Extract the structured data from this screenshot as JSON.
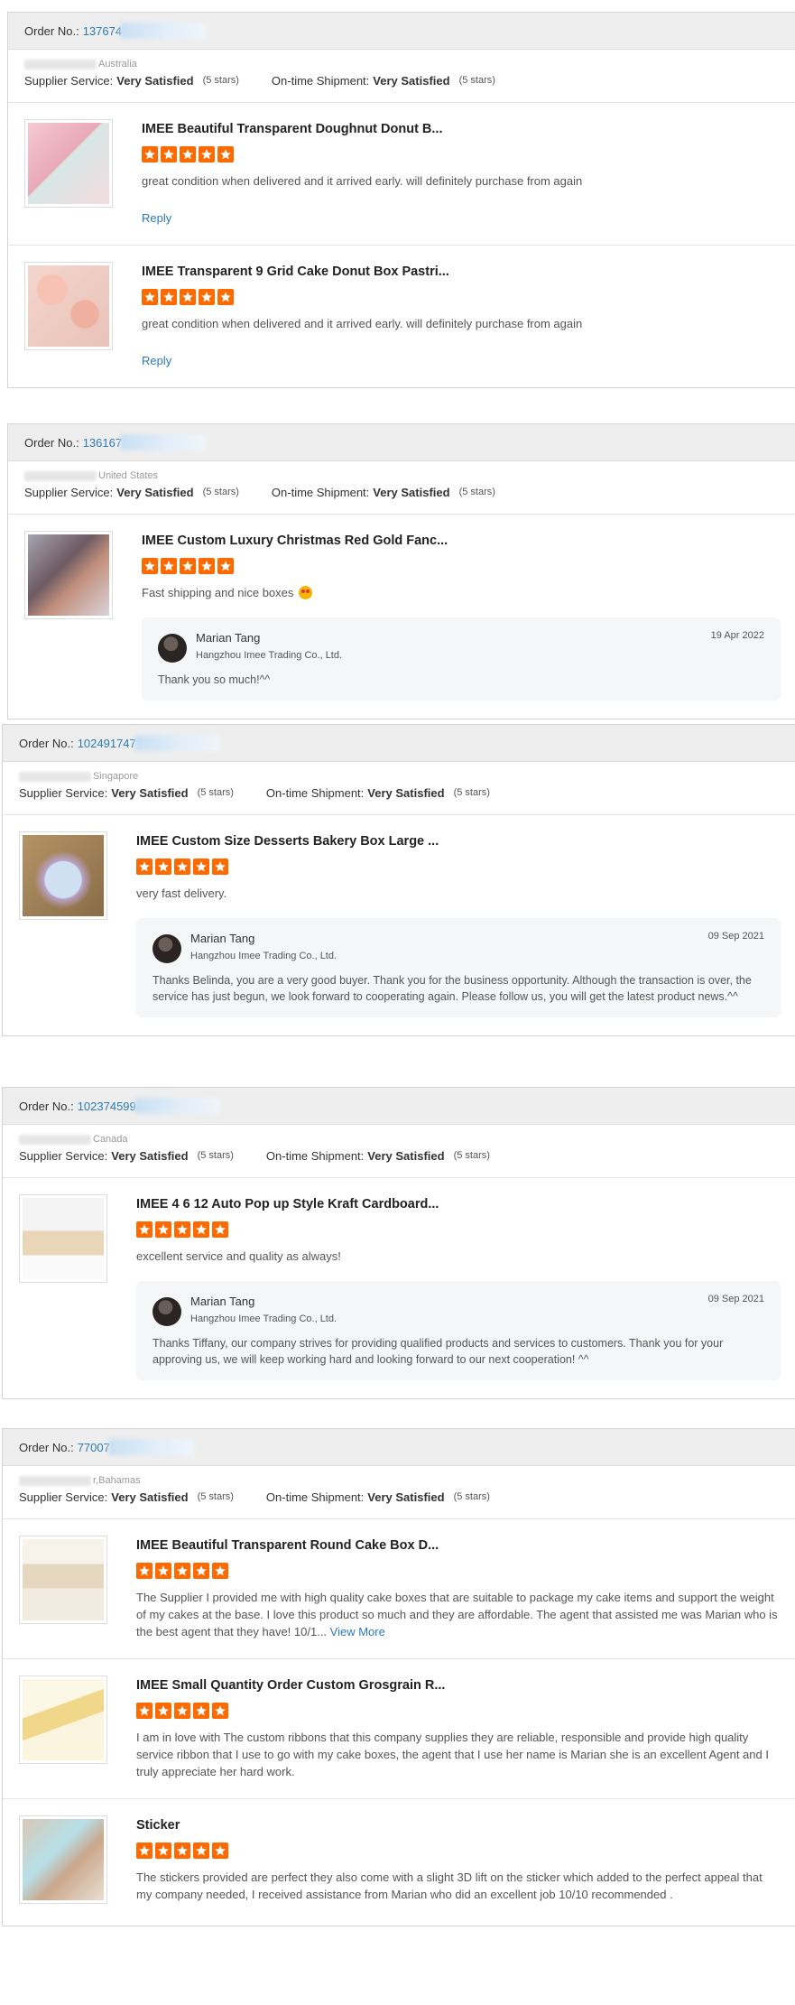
{
  "labels": {
    "order_no": "Order No.:",
    "supplier_service": "Supplier Service:",
    "on_time_shipment": "On-time Shipment:",
    "reply": "Reply"
  },
  "colors": {
    "accent": "#2a7ab8",
    "star": "#ff6a00",
    "header_bg": "#eeeeee"
  },
  "orders": [
    {
      "order_no": "137674",
      "country": "Australia",
      "supplier_service": "Very Satisfied",
      "supplier_stars": "(5 stars)",
      "shipment": "Very Satisfied",
      "shipment_stars": "(5 stars)",
      "items": [
        {
          "title": "IMEE Beautiful Transparent Doughnut Donut B...",
          "rating": 5,
          "text": "great condition when delivered and it arrived early. will definitely purchase from again",
          "reply_link": "Reply",
          "thumb": "pink-donut-box"
        },
        {
          "title": "IMEE Transparent 9 Grid Cake Donut Box Pastri...",
          "rating": 5,
          "text": "great condition when delivered and it arrived early. will definitely purchase from again",
          "reply_link": "Reply",
          "thumb": "nine-grid-box"
        }
      ]
    },
    {
      "order_no": "136167",
      "country": "United States",
      "supplier_service": "Very Satisfied",
      "supplier_stars": "(5 stars)",
      "shipment": "Very Satisfied",
      "shipment_stars": "(5 stars)",
      "items": [
        {
          "title": "IMEE Custom Luxury Christmas Red Gold Fanc...",
          "rating": 5,
          "text": "Fast shipping and nice boxes",
          "emoji": "star-struck-emoji",
          "thumb": "christmas-box",
          "reply": {
            "name": "Marian Tang",
            "company": "Hangzhou Imee Trading Co., Ltd.",
            "date": "19 Apr 2022",
            "text": "Thank you so much!^^"
          }
        }
      ]
    },
    {
      "order_no": "102491747",
      "country": "Singapore",
      "supplier_service": "Very Satisfied",
      "supplier_stars": "(5 stars)",
      "shipment": "Very Satisfied",
      "shipment_stars": "(5 stars)",
      "items": [
        {
          "title": "IMEE Custom Size Desserts Bakery Box Large ...",
          "rating": 5,
          "text": "very fast delivery.",
          "thumb": "dessert-box",
          "reply": {
            "name": "Marian Tang",
            "company": "Hangzhou Imee Trading Co., Ltd.",
            "date": "09 Sep 2021",
            "text": "Thanks Belinda, you are a very good buyer. Thank you for the business opportunity. Although the transaction is over, the service has just begun, we look forward to cooperating again. Please follow us, you will get the latest product news.^^"
          }
        }
      ]
    },
    {
      "order_no": "102374599",
      "country": "Canada",
      "supplier_service": "Very Satisfied",
      "supplier_stars": "(5 stars)",
      "shipment": "Very Satisfied",
      "shipment_stars": "(5 stars)",
      "items": [
        {
          "title": "IMEE 4 6 12 Auto Pop up Style Kraft Cardboard...",
          "rating": 5,
          "text": "excellent service and quality as always!",
          "thumb": "kraft-box",
          "reply": {
            "name": "Marian Tang",
            "company": "Hangzhou Imee Trading Co., Ltd.",
            "date": "09 Sep 2021",
            "text": "Thanks Tiffany,  our company strives for providing qualified products and services to customers. Thank you for your approving us, we will keep working hard and looking forward to our next cooperation! ^^"
          }
        }
      ]
    },
    {
      "order_no": "77007",
      "country": "r,Bahamas",
      "supplier_service": "Very Satisfied",
      "supplier_stars": "(5 stars)",
      "shipment": "Very Satisfied",
      "shipment_stars": "(5 stars)",
      "items": [
        {
          "title": "IMEE Beautiful Transparent Round Cake Box D...",
          "rating": 5,
          "text": "The Supplier I provided me with high quality cake boxes that are suitable to package my cake items and support the weight of my cakes at the base. I love this product so much and they are affordable. The agent that assisted me was Marian who is the best agent that they have! 10/1...",
          "view_more": "View More",
          "thumb": "round-cake-box"
        },
        {
          "title": "IMEE Small Quantity Order Custom Grosgrain R...",
          "rating": 5,
          "text": "I am in love with The custom ribbons that this company supplies they are reliable, responsible and provide high quality service ribbon that I use to go with my cake boxes, the agent that I use her name is Marian she is an excellent Agent and I truly appreciate her hard work.",
          "thumb": "ribbon-candy-girl"
        },
        {
          "title": "Sticker",
          "rating": 5,
          "text": "The stickers provided are perfect they also come with a slight 3D lift on the sticker which added to the perfect appeal that my company needed, I received assistance from Marian who did an excellent job 10/10 recommended .",
          "thumb": "sticker-box"
        }
      ]
    }
  ]
}
